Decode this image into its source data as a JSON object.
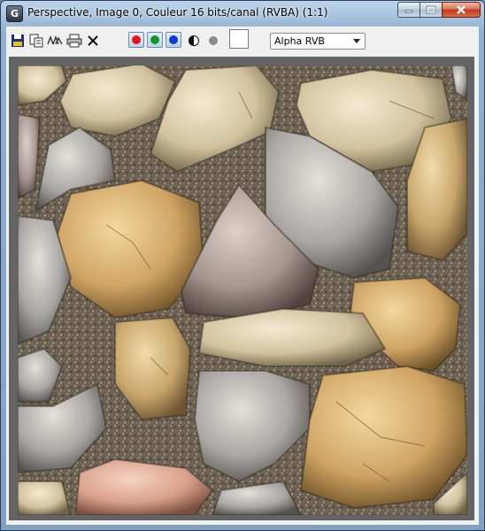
{
  "window": {
    "title": "Perspective, Image 0, Couleur 16 bits/canal (RVBA) (1:1)",
    "app_icon_letter": "G"
  },
  "toolbar": {
    "icons": [
      "save-icon",
      "copy-icon",
      "clone-icon",
      "print-icon",
      "clear-icon"
    ],
    "channels": [
      {
        "name": "red-channel",
        "color": "#e0141a"
      },
      {
        "name": "green-channel",
        "color": "#0e9a2a"
      },
      {
        "name": "blue-channel",
        "color": "#1238d8"
      }
    ],
    "display_mode": "Alpha RVB"
  },
  "colors": {
    "grout": "#6f6455",
    "viewport": "#646464",
    "toolbar_bg": "#f0f0f0"
  }
}
